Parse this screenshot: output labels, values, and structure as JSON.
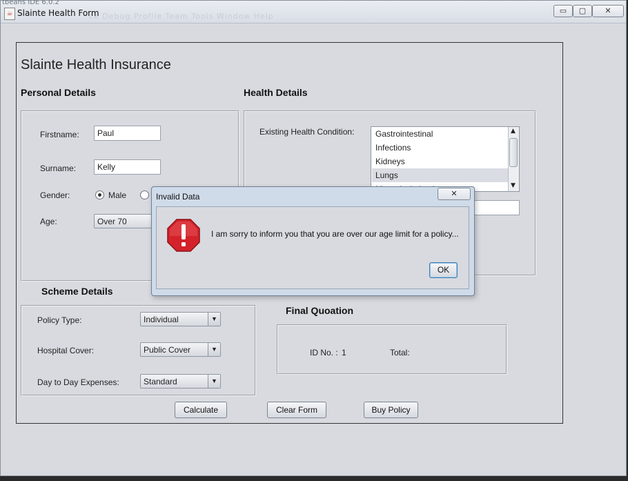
{
  "window": {
    "background_title": "tbeans IDE 6.0.2",
    "ghost_menu": "ce  Debug  Profile  Team  Tools  Window  Help",
    "title": "Slainte Health Form",
    "minimize": "▭",
    "maximize": "▢",
    "close": "✕"
  },
  "form": {
    "heading": "Slainte Health Insurance",
    "personal": {
      "title": "Personal Details",
      "firstname_label": "Firstname:",
      "firstname_value": "Paul",
      "surname_label": "Surname:",
      "surname_value": "Kelly",
      "gender_label": "Gender:",
      "gender_male": "Male",
      "gender_selected": "Male",
      "age_label": "Age:",
      "age_value": "Over 70"
    },
    "health": {
      "title": "Health Details",
      "condition_label": "Existing Health Condition:",
      "conditions": [
        "Gastrointestinal",
        "Infections",
        "Kidneys",
        "Lungs",
        "Musculoskeletal"
      ],
      "selected_condition": "Lungs"
    },
    "scheme": {
      "title": "Scheme Details",
      "policy_type_label": "Policy Type:",
      "policy_type_value": "Individual",
      "hospital_cover_label": "Hospital Cover:",
      "hospital_cover_value": "Public Cover",
      "expenses_label": "Day to Day Expenses:",
      "expenses_value": "Standard"
    },
    "quote": {
      "title": "Final Quoation",
      "id_label": "ID No. :",
      "id_value": "1",
      "total_label": "Total:"
    },
    "buttons": {
      "calculate": "Calculate",
      "clear": "Clear Form",
      "buy": "Buy Policy"
    }
  },
  "dialog": {
    "title": "Invalid Data",
    "close": "✕",
    "icon": "error-icon",
    "message": "I am sorry to inform you that you are over our age limit for a policy...",
    "ok": "OK",
    "icon_color": "#d3222a"
  },
  "icons": {
    "combo_arrow": "▼",
    "scroll_up": "▲",
    "scroll_down": "▼",
    "app": "☕"
  }
}
